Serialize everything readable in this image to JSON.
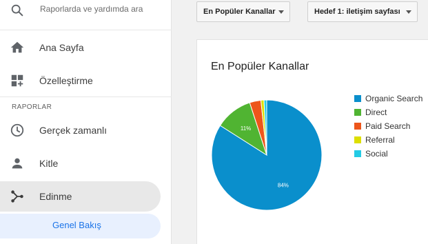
{
  "sidebar": {
    "search_placeholder": "Raporlarda ve yardımda ara",
    "items": [
      {
        "label": "Ana Sayfa",
        "icon": "home-icon"
      },
      {
        "label": "Özelleştirme",
        "icon": "dashboard-customize-icon"
      }
    ],
    "section_label": "RAPORLAR",
    "report_items": [
      {
        "label": "Gerçek zamanlı",
        "icon": "clock-icon"
      },
      {
        "label": "Kitle",
        "icon": "person-icon"
      },
      {
        "label": "Edinme",
        "icon": "acquisition-icon",
        "active": true
      }
    ],
    "sub_item": {
      "label": "Genel Bakış",
      "active": true
    }
  },
  "filters": {
    "channel_select": "En Popüler Kanallar",
    "goal_select": "Hedef 1: iletişim sayfası"
  },
  "card": {
    "title": "En Popüler Kanallar"
  },
  "chart_data": {
    "type": "pie",
    "title": "En Popüler Kanallar",
    "slices": [
      {
        "name": "Organic Search",
        "value": 84,
        "color": "#0a8fcc",
        "label": "84%"
      },
      {
        "name": "Direct",
        "value": 11,
        "color": "#50b432",
        "label": "11%"
      },
      {
        "name": "Paid Search",
        "value": 3.3,
        "color": "#ed561b",
        "label": ""
      },
      {
        "name": "Referral",
        "value": 0.9,
        "color": "#dddf00",
        "label": ""
      },
      {
        "name": "Social",
        "value": 0.8,
        "color": "#24cbe5",
        "label": ""
      }
    ],
    "legend_position": "right"
  },
  "colors": {
    "accent": "#1a73e8",
    "active_bg": "#e8e8e8",
    "sub_active_bg": "#e8f0fe"
  }
}
